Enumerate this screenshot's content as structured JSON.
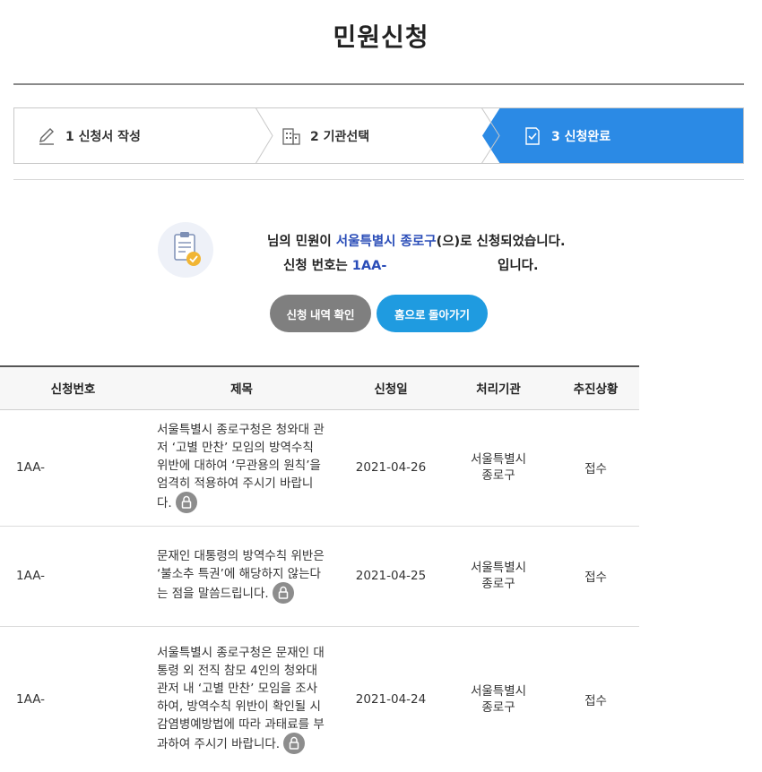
{
  "page": {
    "title": "민원신청"
  },
  "steps": [
    {
      "label": "1 신청서 작성",
      "icon": "pencil-icon"
    },
    {
      "label": "2 기관선택",
      "icon": "building-icon"
    },
    {
      "label": "3 신청완료",
      "icon": "document-check-icon"
    }
  ],
  "result": {
    "line1_prefix": "님의 민원이 ",
    "agency": "서울특별시 종로구",
    "line1_suffix": "(으)로 신청되었습니다.",
    "line2_prefix": "신청 번호는 ",
    "application_no": "1AA-",
    "line2_suffix": "입니다."
  },
  "buttons": {
    "check_label": "신청 내역 확인",
    "home_label": "홈으로 돌아가기"
  },
  "table": {
    "headers": [
      "신청번호",
      "제목",
      "신청일",
      "처리기관",
      "추진상황"
    ],
    "rows": [
      {
        "no": "1AA-",
        "title": "서울특별시 종로구청은 청와대 관저 ‘고별 만찬’ 모임의 방역수칙 위반에 대하여 ‘무관용의 원칙’을 엄격히 적용하여 주시기 바랍니다.",
        "date": "2021-04-26",
        "org": "서울특별시 종로구",
        "status": "접수"
      },
      {
        "no": "1AA-",
        "title": "문재인 대통령의 방역수칙 위반은 ‘불소추 특권’에 해당하지 않는다는 점을 말씀드립니다.",
        "date": "2021-04-25",
        "org": "서울특별시 종로구",
        "status": "접수"
      },
      {
        "no": "1AA-",
        "title": "서울특별시 종로구청은 문재인 대통령 외 전직 참모 4인의 청와대 관저 내 ‘고별 만찬’ 모임을 조사하여, 방역수칙 위반이 확인될 시 감염병예방법에 따라 과태료를 부과하여 주시기 바랍니다.",
        "date": "2021-04-24",
        "org": "서울특별시 종로구",
        "status": "접수"
      }
    ]
  },
  "colors": {
    "accent_blue": "#2b8ae5",
    "home_button": "#1f9be0",
    "check_button": "#7f7f7f",
    "highlight_text": "#2a4db8"
  }
}
